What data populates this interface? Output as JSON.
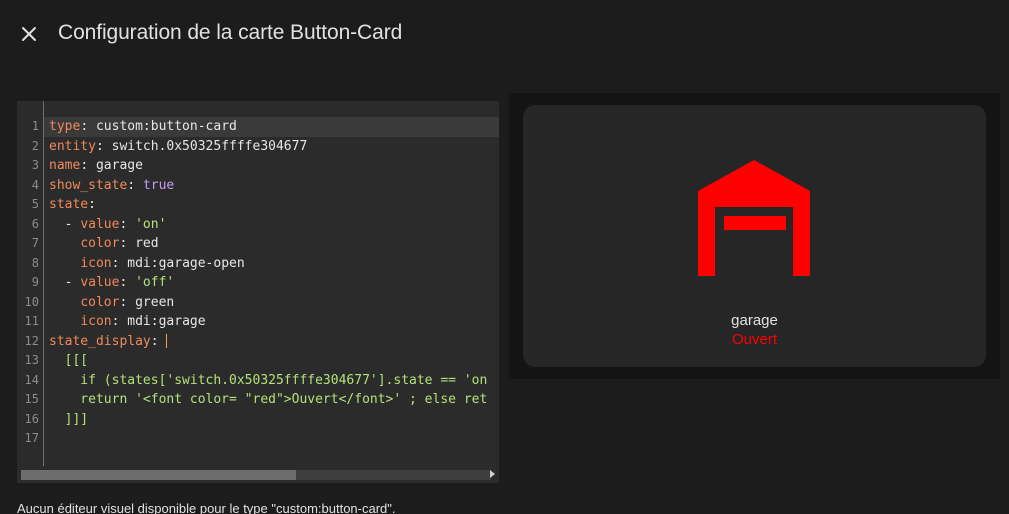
{
  "dialog": {
    "title": "Configuration de la carte Button-Card",
    "close_icon": "close-icon"
  },
  "editor": {
    "line_numbers": [
      "1",
      "2",
      "3",
      "4",
      "5",
      "6",
      "7",
      "8",
      "9",
      "10",
      "11",
      "12",
      "13",
      "14",
      "15",
      "16",
      "17"
    ],
    "active_line": 1,
    "lines": [
      [
        [
          "k",
          "type"
        ],
        [
          "p",
          ": custom:button-card"
        ]
      ],
      [
        [
          "k",
          "entity"
        ],
        [
          "p",
          ": switch.0x50325ffffe304677"
        ]
      ],
      [
        [
          "k",
          "name"
        ],
        [
          "p",
          ": garage"
        ]
      ],
      [
        [
          "k",
          "show_state"
        ],
        [
          "p",
          ": "
        ],
        [
          "b",
          "true"
        ]
      ],
      [
        [
          "k",
          "state"
        ],
        [
          "p",
          ":"
        ]
      ],
      [
        [
          "p",
          "  - "
        ],
        [
          "k",
          "value"
        ],
        [
          "p",
          ": "
        ],
        [
          "s",
          "'on'"
        ]
      ],
      [
        [
          "p",
          "    "
        ],
        [
          "k",
          "color"
        ],
        [
          "p",
          ": red"
        ]
      ],
      [
        [
          "p",
          "    "
        ],
        [
          "k",
          "icon"
        ],
        [
          "p",
          ": mdi:garage-open"
        ]
      ],
      [
        [
          "p",
          "  - "
        ],
        [
          "k",
          "value"
        ],
        [
          "p",
          ": "
        ],
        [
          "s",
          "'off'"
        ]
      ],
      [
        [
          "p",
          "    "
        ],
        [
          "k",
          "color"
        ],
        [
          "p",
          ": green"
        ]
      ],
      [
        [
          "p",
          "    "
        ],
        [
          "k",
          "icon"
        ],
        [
          "p",
          ": mdi:garage"
        ]
      ],
      [
        [
          "k",
          "state_display"
        ],
        [
          "p",
          ": "
        ],
        [
          "cursor",
          ""
        ]
      ],
      [
        [
          "s",
          "  [[["
        ]
      ],
      [
        [
          "s",
          "    if (states['switch.0x50325ffffe304677'].state == 'on"
        ]
      ],
      [
        [
          "s",
          "    return '<font color= \"red\">Ouvert</font>' ; else ret"
        ]
      ],
      [
        [
          "s",
          "  ]]]"
        ]
      ],
      []
    ]
  },
  "preview": {
    "icon": "garage-open-icon",
    "icon_color": "#ff0000",
    "name": "garage",
    "state": "Ouvert",
    "state_color": "#ff0000"
  },
  "notice": "Aucun éditeur visuel disponible pour le type \"custom:button-card\"."
}
